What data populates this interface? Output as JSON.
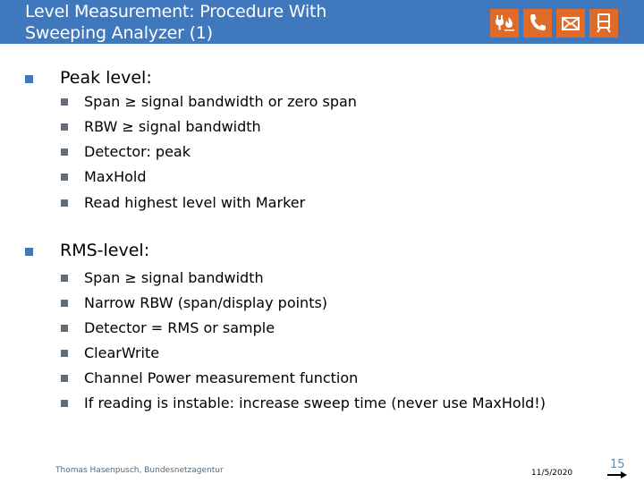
{
  "header": {
    "title_line1": "Level Measurement: Procedure With",
    "title_line2": "Sweeping Analyzer (1)",
    "background_color": "#4078bd",
    "icons": [
      {
        "name": "plug-flame-icon",
        "color": "#e06a28"
      },
      {
        "name": "phone-icon",
        "color": "#e06a28"
      },
      {
        "name": "envelope-icon",
        "color": "#e06a28"
      },
      {
        "name": "train-icon",
        "color": "#e06a28"
      }
    ]
  },
  "content": {
    "sections": [
      {
        "heading": "Peak level:",
        "items": [
          "Span ≥ signal bandwidth or zero span",
          "RBW ≥ signal bandwidth",
          "Detector: peak",
          "MaxHold",
          "Read highest level with Marker"
        ]
      },
      {
        "heading": "RMS-level:",
        "items": [
          "Span ≥ signal bandwidth",
          "Narrow RBW  (span/display points)",
          "Detector = RMS or sample",
          "ClearWrite",
          "Channel Power measurement function",
          "If reading is instable: increase sweep time (never use MaxHold!)"
        ]
      }
    ]
  },
  "footer": {
    "author": "Thomas Hasenpusch, Bundesnetzagentur",
    "date": "11/5/2020",
    "page_number": "15"
  }
}
